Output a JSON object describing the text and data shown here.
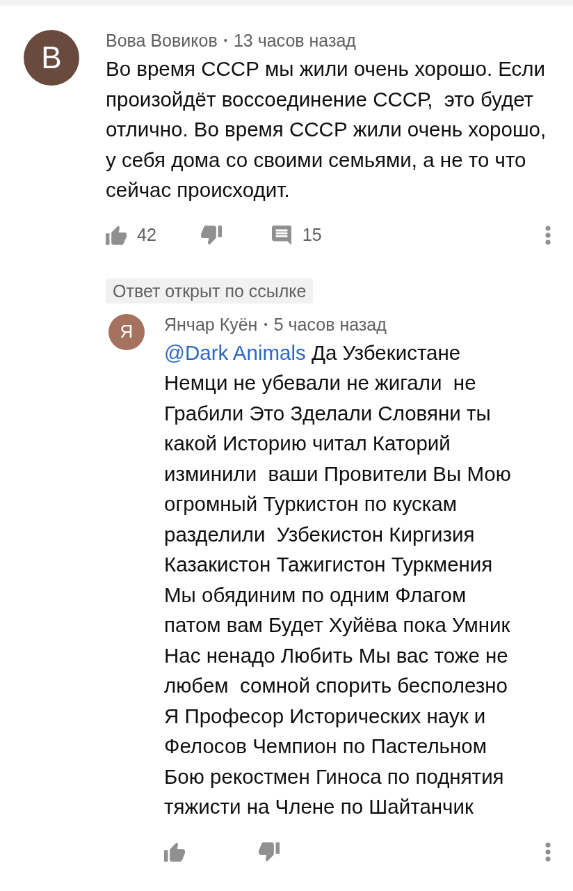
{
  "comment": {
    "avatar_letter": "В",
    "author": "Вова Вовиков",
    "separator": "•",
    "time": "13 часов назад",
    "text": "Во время СССР мы жили очень хорошо. Если произойдёт воссоединение СССР,  это будет отлично. Во время СССР жили очень хорошо, у себя дома со своими семьями, а не то что сейчас происходит.",
    "likes": "42",
    "replies": "15"
  },
  "badge": "Ответ открыт по ссылке",
  "reply": {
    "avatar_letter": "Я",
    "author": "Янчар Куён",
    "separator": "•",
    "time": "5 часов назад",
    "mention": "@Dark Animals",
    "text": "Да Узбекистане Немци не убевали не жигали  не Грабили Это Зделали Словяни ты какой Историю читал Каторий изминили  ваши Провители Вы Мою огромный Туркистон по кускам разделили  Узбекистон Киргизия Казакистон Тажигистон Туркмения Мы обядиним по одним Флагом патом вам Будет Хуйёва пока Умник Нас ненадо Любить Мы вас тоже не любем  сомной спорить бесполезно Я Професор Исторических наук и Фелосов Чемпион по Пастельном Бою рекостмен Гиноса по поднятия тяжисти на Члене по Шайтанчик"
  }
}
